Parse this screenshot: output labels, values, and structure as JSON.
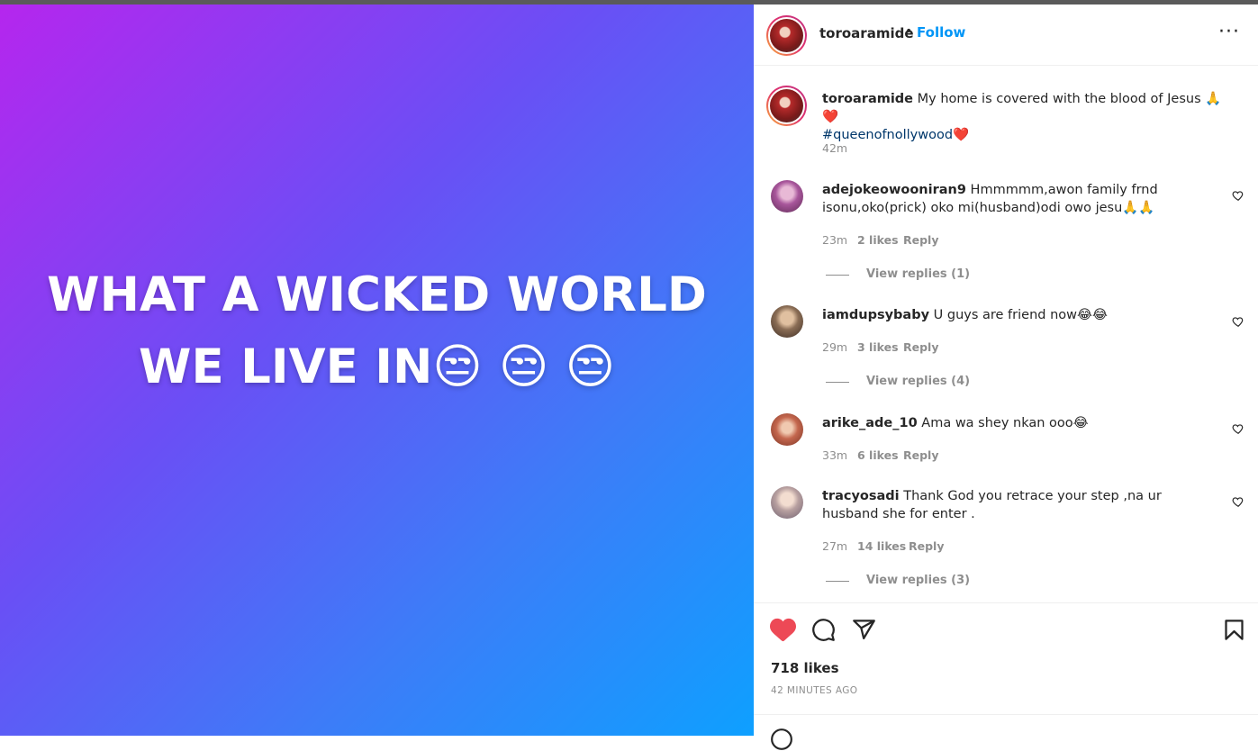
{
  "media": {
    "line1": "WHAT A WICKED WORLD",
    "line2": "WE LIVE IN😒 😒 😒"
  },
  "header": {
    "username": "toroaramide",
    "dot": "•",
    "follow_label": "Follow",
    "more_label": "···"
  },
  "caption": {
    "username": "toroaramide",
    "text": " My home is covered with the blood of Jesus 🙏❤️",
    "hashtag": "#queenofnollywood",
    "hashtag_suffix": "❤️",
    "time": "42m"
  },
  "comments": [
    {
      "username": "adejokeowooniran9",
      "text": " Hmmmmm,awon family frnd isonu,oko(prick) oko mi(husband)odi owo jesu🙏🙏",
      "time": "23m",
      "likes": "2 likes",
      "reply": "Reply",
      "view_replies": "View replies (1)"
    },
    {
      "username": "iamdupsybaby",
      "text": " U guys are friend now😂😂",
      "time": "29m",
      "likes": "3 likes",
      "reply": "Reply",
      "view_replies": "View replies (4)"
    },
    {
      "username": "arike_ade_10",
      "text": " Ama wa shey nkan ooo😂",
      "time": "33m",
      "likes": "6 likes",
      "reply": "Reply",
      "view_replies": ""
    },
    {
      "username": "tracyosadi",
      "text": " Thank God you retrace your step ,na ur husband she for enter .",
      "time": "27m",
      "likes": "14 likes",
      "reply": "Reply",
      "view_replies": "View replies (3)"
    }
  ],
  "footer": {
    "likes": "718 likes",
    "time_ago": "42 MINUTES AGO"
  },
  "icons": {
    "like": "heart-filled-icon",
    "comment": "comment-icon",
    "share": "paper-plane-icon",
    "save": "bookmark-icon",
    "comment_like": "heart-outline-icon"
  },
  "colors": {
    "like_red": "#ed4956",
    "link_blue": "#0095f6",
    "hashtag": "#00376b",
    "muted": "#8e8e8e"
  }
}
